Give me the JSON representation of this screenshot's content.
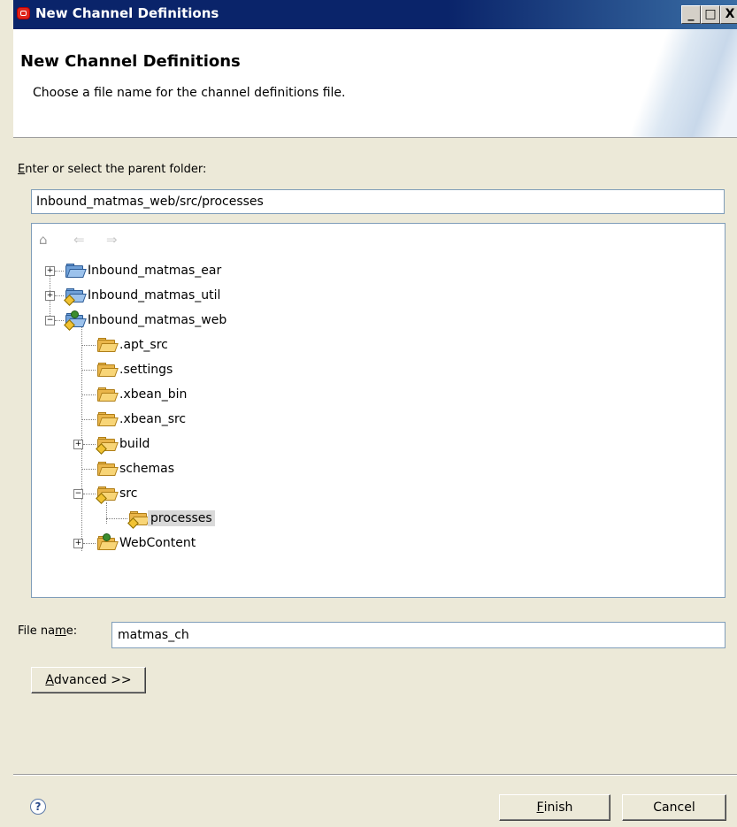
{
  "window": {
    "title": "New Channel Definitions",
    "controls": [
      "_",
      "□",
      "X"
    ]
  },
  "header": {
    "title": "New Channel Definitions",
    "description": "Choose a file name for the channel definitions file."
  },
  "parent_folder": {
    "label_mnemonic": "E",
    "label_rest": "nter or select the parent folder:",
    "value": "Inbound_matmas_web/src/processes"
  },
  "tree": {
    "toolbar": {
      "home_icon": "home-icon",
      "back_icon": "back-arrow-icon",
      "forward_icon": "forward-arrow-icon"
    },
    "items": [
      {
        "label": "Inbound_matmas_ear",
        "icon": "project-folder-icon",
        "expander": "+"
      },
      {
        "label": "Inbound_matmas_util",
        "icon": "project-folder-icon",
        "expander": "+"
      },
      {
        "label": "Inbound_matmas_web",
        "icon": "web-project-folder-icon",
        "expander": "−"
      },
      {
        "label": ".apt_src",
        "icon": "folder-icon"
      },
      {
        "label": ".settings",
        "icon": "folder-icon"
      },
      {
        "label": ".xbean_bin",
        "icon": "folder-icon"
      },
      {
        "label": ".xbean_src",
        "icon": "folder-icon"
      },
      {
        "label": "build",
        "icon": "source-folder-icon",
        "expander": "+"
      },
      {
        "label": "schemas",
        "icon": "folder-icon"
      },
      {
        "label": "src",
        "icon": "source-folder-icon",
        "expander": "−"
      },
      {
        "label": "processes",
        "icon": "source-folder-icon",
        "selected": true
      },
      {
        "label": "WebContent",
        "icon": "web-folder-icon",
        "expander": "+"
      }
    ]
  },
  "file_name": {
    "label_pre": "File na",
    "label_mnemonic": "m",
    "label_post": "e:",
    "value": "matmas_ch"
  },
  "buttons": {
    "advanced_mnemonic": "A",
    "advanced_rest": "dvanced >>",
    "finish_mnemonic": "F",
    "finish_rest": "inish",
    "cancel": "Cancel",
    "help_icon": "help-icon"
  }
}
